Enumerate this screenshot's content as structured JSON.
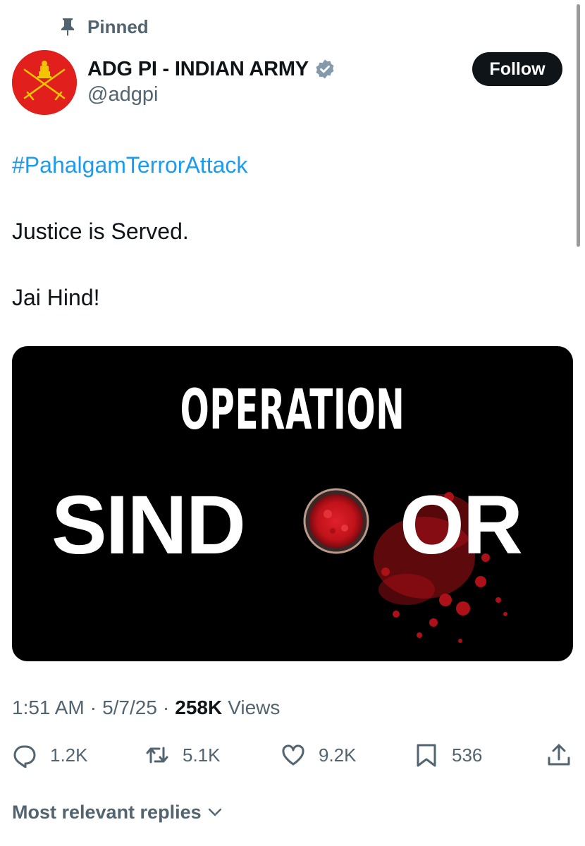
{
  "pinned": {
    "label": "Pinned",
    "icon": "pin-icon"
  },
  "author": {
    "name": "ADG PI - INDIAN ARMY",
    "handle": "@adgpi",
    "verified_icon": "verified-badge-icon",
    "avatar_icon": "army-emblem-icon"
  },
  "follow_label": "Follow",
  "tweet": {
    "hashtag": "#PahalgamTerrorAttack",
    "line1": "Justice is Served.",
    "line2": "Jai Hind!"
  },
  "media": {
    "title_top": "OPERATION",
    "title_left": "SIND",
    "title_right": "OR"
  },
  "meta": {
    "time": "1:51 AM",
    "date": "5/7/25",
    "views_count": "258K",
    "views_label": "Views",
    "separator": "·"
  },
  "actions": {
    "reply_count": "1.2K",
    "repost_count": "5.1K",
    "like_count": "9.2K",
    "bookmark_count": "536"
  },
  "replies_sort_label": "Most relevant replies",
  "colors": {
    "accent": "#1d9bf0",
    "text_primary": "#0f1419",
    "text_secondary": "#536471",
    "verified": "#829aab",
    "sindoor_red": "#d0121b"
  }
}
